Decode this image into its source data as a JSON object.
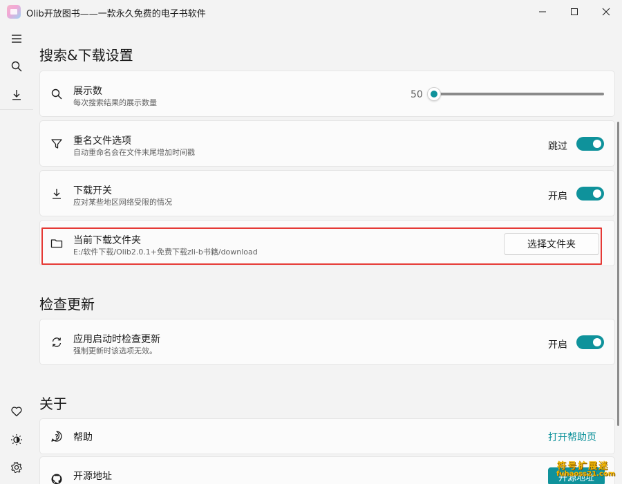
{
  "window": {
    "title": "Olib开放图书——一款永久免费的电子书软件"
  },
  "nav": {
    "items": [
      {
        "icon": "menu-icon"
      },
      {
        "icon": "search-icon"
      },
      {
        "icon": "download-icon"
      }
    ],
    "bottom_items": [
      {
        "icon": "heart-icon"
      },
      {
        "icon": "theme-icon"
      },
      {
        "icon": "gear-icon"
      }
    ]
  },
  "search_download": {
    "title": "搜索&下载设置",
    "display_count": {
      "title": "展示数",
      "subtitle": "每次搜索结果的展示数量",
      "value": "50",
      "slider_fraction": 0
    },
    "rename": {
      "title": "重名文件选项",
      "subtitle": "自动重命名会在文件末尾增加时间戳",
      "state_label": "跳过"
    },
    "download_switch": {
      "title": "下载开关",
      "subtitle": "应对某些地区网络受限的情况",
      "state_label": "开启"
    },
    "download_folder": {
      "title": "当前下载文件夹",
      "path": "E:/软件下载/Olib2.0.1+免费下载zli-b书籍/download",
      "button_label": "选择文件夹"
    }
  },
  "updates": {
    "title": "检查更新",
    "check_on_start": {
      "title": "应用启动时检查更新",
      "subtitle": "强制更新时该选项无效。",
      "state_label": "开启"
    }
  },
  "about": {
    "title": "关于",
    "help": {
      "title": "帮助",
      "link_label": "打开帮助页"
    },
    "source": {
      "title": "开源地址",
      "button_label": "开源地址"
    }
  },
  "watermark": {
    "line1": "符号扩展迷",
    "line2": "fuhaoss21.com"
  },
  "colors": {
    "accent": "#0f929b",
    "highlight_border": "#e53935",
    "background": "#f3f3f3",
    "card": "#fbfbfb"
  }
}
